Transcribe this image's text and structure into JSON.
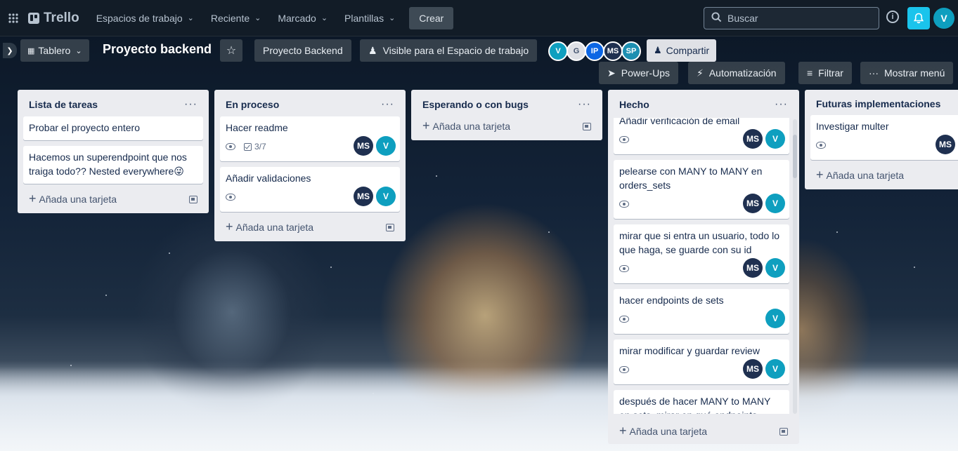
{
  "app": {
    "brand": "Trello",
    "nav": [
      "Espacios de trabajo",
      "Reciente",
      "Marcado",
      "Plantillas"
    ],
    "create_label": "Crear",
    "search_placeholder": "Buscar",
    "user_initial": "V"
  },
  "board": {
    "view_label": "Tablero",
    "title": "Proyecto backend",
    "workspace_label": "Proyecto Backend",
    "visibility_label": "Visible para el Espacio de trabajo",
    "members": [
      {
        "initials": "V",
        "color": "#0e9fbf"
      },
      {
        "initials": "G",
        "color": "#dfe1e6"
      },
      {
        "initials": "IP",
        "color": "#0c66e4"
      },
      {
        "initials": "MS",
        "color": "#1f3050"
      },
      {
        "initials": "SP",
        "color": "#1d8fb1"
      }
    ],
    "share_label": "Compartir",
    "powerups_label": "Power-Ups",
    "automation_label": "Automatización",
    "filter_label": "Filtrar",
    "menu_label": "Mostrar menú"
  },
  "add_card_label": "Añada una tarjeta",
  "lists": [
    {
      "title": "Lista de tareas",
      "cards": [
        {
          "title": "Probar el proyecto entero"
        },
        {
          "title": "Hacemos un superendpoint que nos traiga todo?? Nested everywhere😜"
        }
      ]
    },
    {
      "title": "En proceso",
      "cards": [
        {
          "title": "Hacer readme",
          "checklist": "3/7",
          "members": [
            "MS",
            "V"
          ]
        },
        {
          "title": "Añadir validaciones",
          "members": [
            "MS",
            "V"
          ]
        }
      ]
    },
    {
      "title": "Esperando o con bugs",
      "cards": []
    },
    {
      "title": "Hecho",
      "cards": [
        {
          "title": "Añadir verificación de email",
          "members": [
            "MS",
            "V"
          ]
        },
        {
          "title": "pelearse con MANY to MANY en orders_sets",
          "members": [
            "MS",
            "V"
          ]
        },
        {
          "title": "mirar que si entra un usuario, todo lo que haga, se guarde con su id",
          "members": [
            "MS",
            "V"
          ]
        },
        {
          "title": "hacer endpoints de sets",
          "members": [
            "V"
          ]
        },
        {
          "title": "mirar modificar y guardar review",
          "members": [
            "MS",
            "V"
          ]
        },
        {
          "title": "después de hacer MANY to MANY en sets, mirar en qué endpoints incluirlo"
        }
      ]
    },
    {
      "title": "Futuras implementaciones",
      "cards": [
        {
          "title": "Investigar multer",
          "members": [
            "MS"
          ]
        }
      ]
    }
  ]
}
